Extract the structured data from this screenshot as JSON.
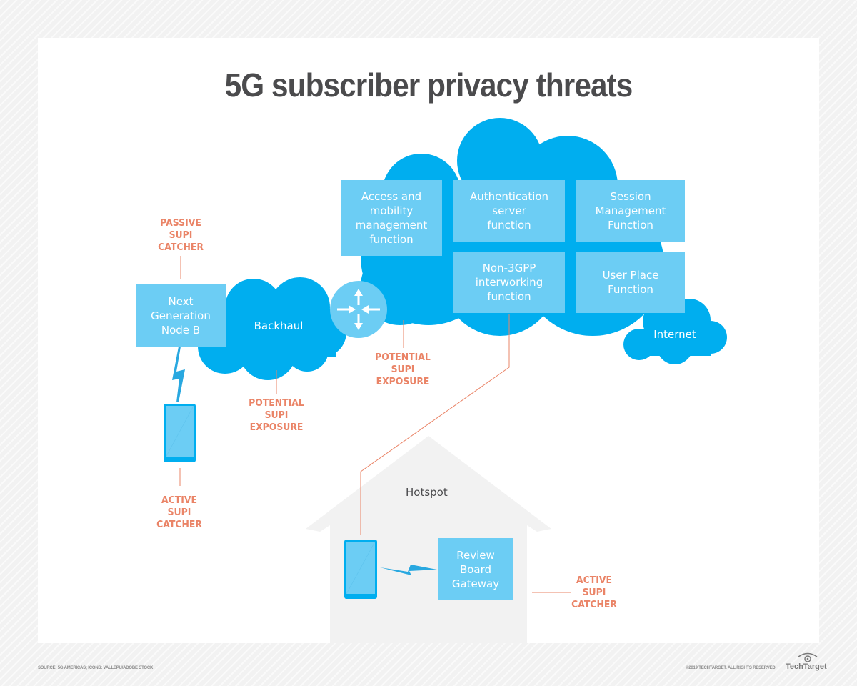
{
  "title": "5G subscriber privacy threats",
  "colors": {
    "cloud": "#00aeef",
    "box": "#6ccdf4",
    "threat": "#ea8467",
    "house": "#f2f2f2",
    "title": "#4b4b4d"
  },
  "network_functions": [
    {
      "id": "amf",
      "label": "Access and\nmobility\nmanagement\nfunction"
    },
    {
      "id": "ausf",
      "label": "Authentication\nserver\nfunction"
    },
    {
      "id": "smf",
      "label": "Session\nManagement\nFunction"
    },
    {
      "id": "n3iwf",
      "label": "Non-3GPP\ninterworking\nfunction"
    },
    {
      "id": "upf",
      "label": "User Place\nFunction"
    }
  ],
  "nodes": {
    "gnb": "Next\nGeneration\nNode B",
    "backhaul": "Backhaul",
    "internet": "Internet",
    "hotspot": "Hotspot",
    "gateway": "Review\nBoard\nGateway"
  },
  "icons": {
    "router": "router-icon",
    "phone": "smartphone-icon",
    "wireless": "lightning-bolt-icon",
    "house": "house-icon",
    "cloud": "cloud-icon"
  },
  "threats": [
    {
      "id": "passive-gnb",
      "label": "PASSIVE\nSUPI\nCATCHER"
    },
    {
      "id": "active-phone",
      "label": "ACTIVE\nSUPI\nCATCHER"
    },
    {
      "id": "exposure-backhaul",
      "label": "POTENTIAL\nSUPI\nEXPOSURE"
    },
    {
      "id": "exposure-core",
      "label": "POTENTIAL\nSUPI\nEXPOSURE"
    },
    {
      "id": "active-hotspot",
      "label": "ACTIVE\nSUPI\nCATCHER"
    }
  ],
  "footer": {
    "source": "SOURCE: 5G AMERICAS; ICONS: VALLEPU/ADOBE STOCK",
    "copyright": "©2019 TECHTARGET. ALL RIGHTS RESERVED",
    "brand": "TechTarget"
  }
}
